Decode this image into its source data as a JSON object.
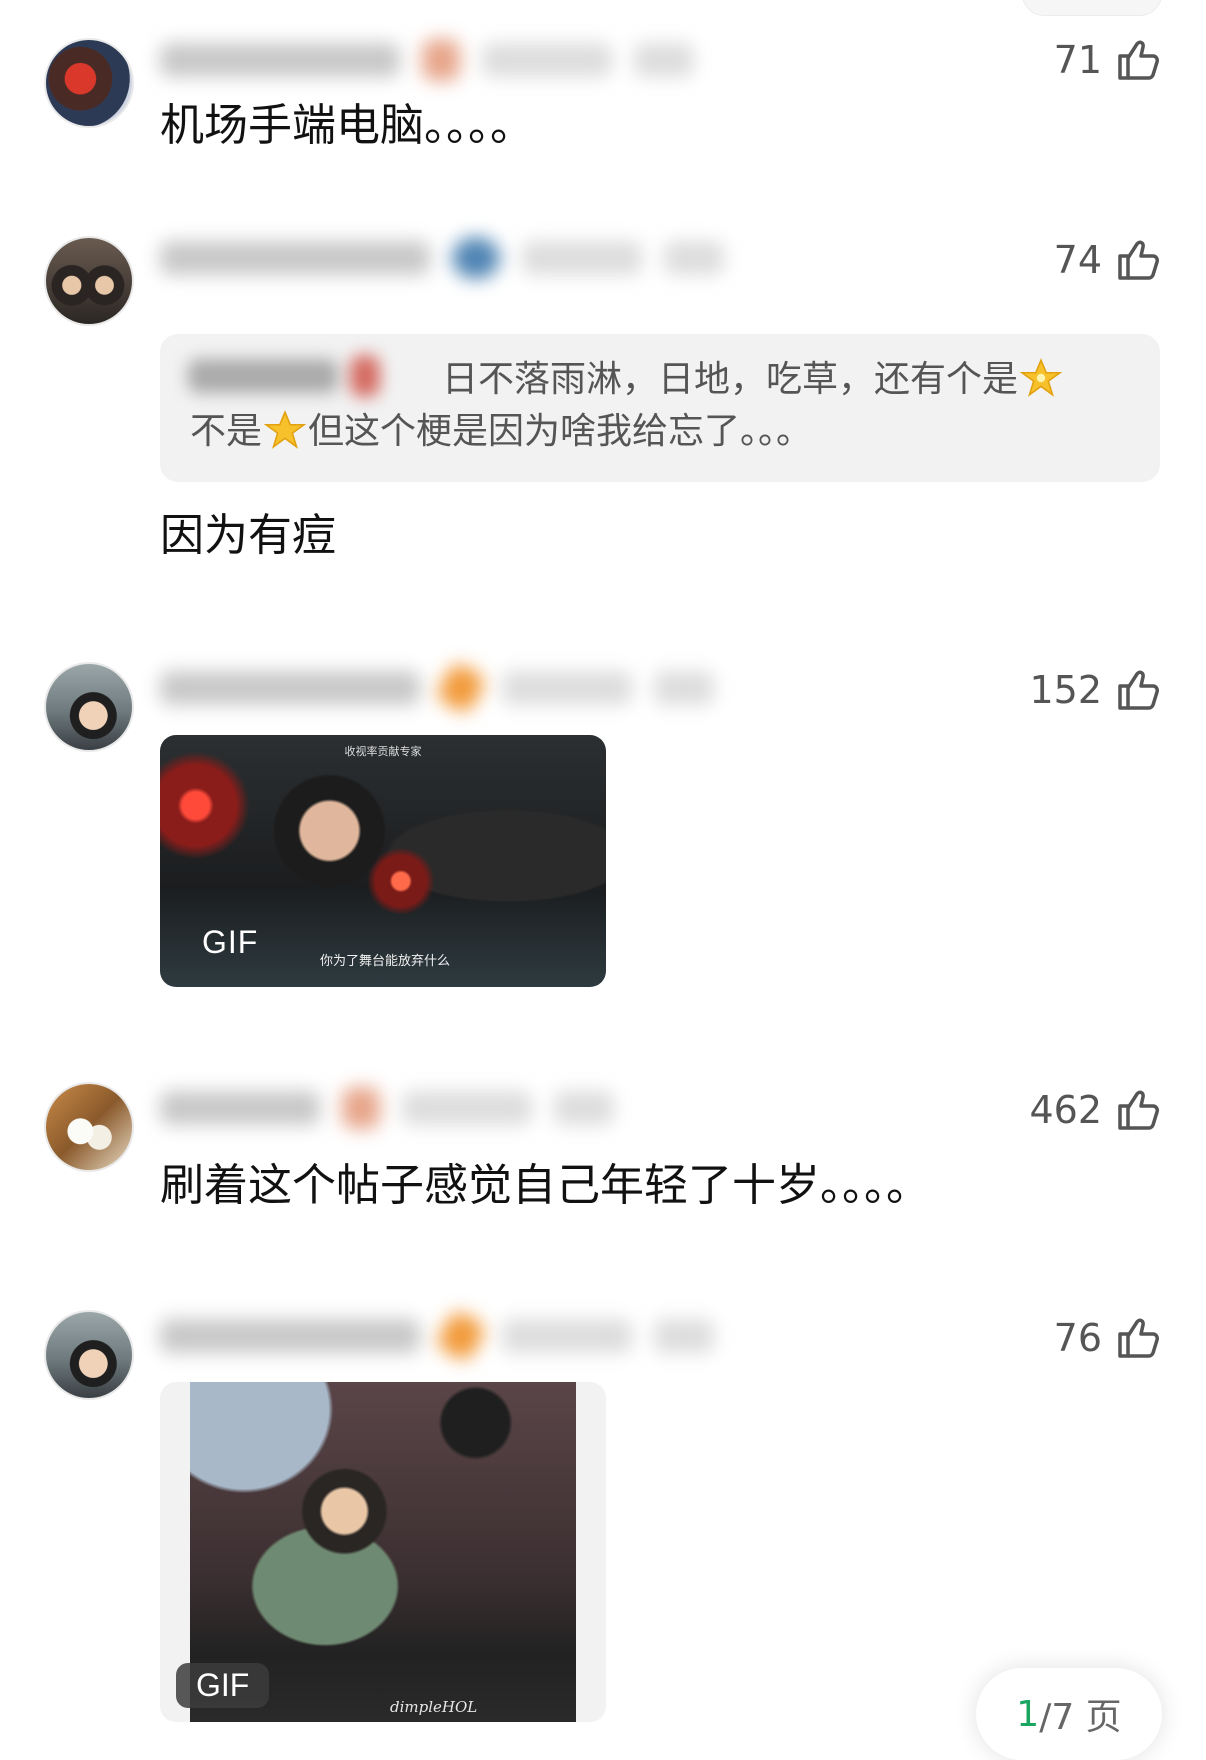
{
  "comments": [
    {
      "likes": "71",
      "text": "机场手端电脑。。。。"
    },
    {
      "likes": "74",
      "quote": {
        "part1": "日不落雨淋，日地，吃草，还有个是",
        "part2": "不是",
        "part3": "但这个梗是因为啥我给忘了。。。"
      },
      "text": "因为有痘"
    },
    {
      "likes": "152",
      "media": {
        "badge": "GIF",
        "caption_top": "收视率贡献专家",
        "subtitle": "你为了舞台能放弃什么"
      }
    },
    {
      "likes": "462",
      "text": "刷着这个帖子感觉自己年轻了十岁。。。。"
    },
    {
      "likes": "76",
      "media": {
        "badge": "GIF",
        "watermark": "dimpleHOL"
      }
    }
  ],
  "pager": {
    "current": "1",
    "total": "/7 页"
  },
  "icons": {
    "like": "thumbs-up-icon",
    "star": "star-emoji-icon",
    "sparkle_star": "glowing-star-emoji-icon"
  },
  "colors": {
    "like_gray": "#555555",
    "pager_accent": "#1aa560",
    "quote_bg": "#f2f2f2"
  }
}
